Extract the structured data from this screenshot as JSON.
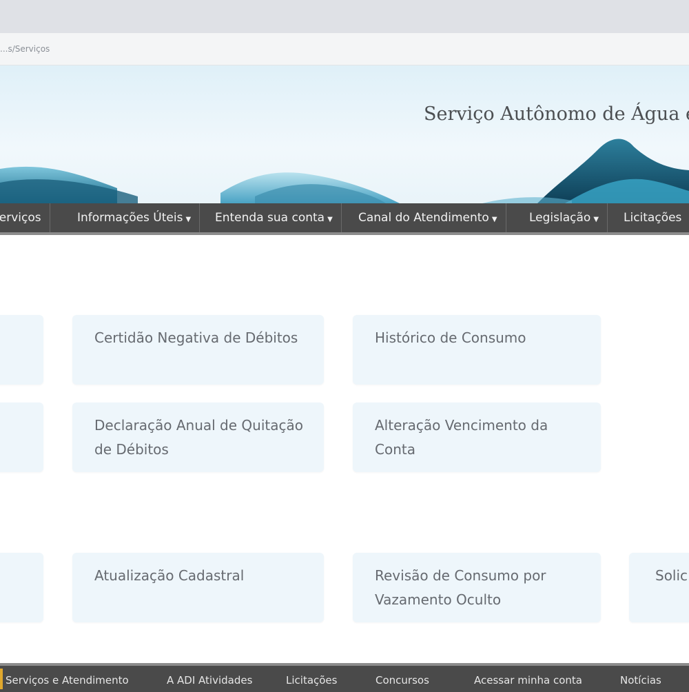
{
  "browser": {
    "address": "...s/Serviços"
  },
  "header": {
    "title": "Serviço Autônomo de Água e"
  },
  "nav": {
    "items": [
      {
        "label": "Serviços",
        "has_caret": false
      },
      {
        "label": "Informações Úteis",
        "has_caret": true
      },
      {
        "label": "Entenda sua conta",
        "has_caret": true
      },
      {
        "label": "Canal do Atendimento",
        "has_caret": true
      },
      {
        "label": "Legislação",
        "has_caret": true
      },
      {
        "label": "Licitações",
        "has_caret": false
      }
    ]
  },
  "services": {
    "row1": [
      {
        "label": ""
      },
      {
        "label": "Certidão Negativa de Débitos"
      },
      {
        "label": "Histórico de Consumo"
      }
    ],
    "row2": [
      {
        "label": ""
      },
      {
        "label": "Declaração Anual de Quitação de Débitos"
      },
      {
        "label": "Alteração Vencimento da Conta"
      }
    ],
    "row3": [
      {
        "label": ""
      },
      {
        "label": "Atualização Cadastral"
      },
      {
        "label": "Revisão de Consumo por Vazamento Oculto"
      },
      {
        "label": "Solic"
      }
    ]
  },
  "footer": {
    "items": [
      "Serviços e Atendimento",
      "A ADI Atividades",
      "Licitações",
      "Concursos",
      "Acessar minha conta",
      "Notícias"
    ]
  },
  "colors": {
    "nav_background": "#4a4a4a",
    "card_background": "#eef6fb",
    "footer_accent": "#e0a82e"
  }
}
